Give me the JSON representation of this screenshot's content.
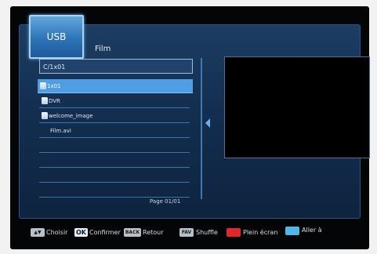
{
  "tab": {
    "label": "USB"
  },
  "section": {
    "title": "Film"
  },
  "path": {
    "value": "C/1x01"
  },
  "list": {
    "items": [
      {
        "label": "1x01",
        "type": "folder",
        "selected": true
      },
      {
        "label": "DVR",
        "type": "folder",
        "selected": false
      },
      {
        "label": "welcome_image",
        "type": "folder",
        "selected": false
      },
      {
        "label": "Film.avi",
        "type": "file",
        "selected": false
      }
    ],
    "page": "Page 01/01"
  },
  "footer": {
    "hints": [
      {
        "key": "▲▼",
        "label": "Choisir"
      },
      {
        "key": "OK",
        "label": "Confirmer"
      },
      {
        "key": "BACK",
        "label": "Retour"
      },
      {
        "key": "FAV",
        "label": "Shuffle"
      },
      {
        "key_color": "#e3252c",
        "label": "Plein écran"
      },
      {
        "key_color": "#4fb7e8",
        "label": "Aller à"
      }
    ]
  },
  "colors": {
    "panel": "#132e4f",
    "selection": "#4f9de2",
    "accent": "#63a7dd",
    "red_key": "#e3252c",
    "blue_key": "#4fb7e8"
  }
}
